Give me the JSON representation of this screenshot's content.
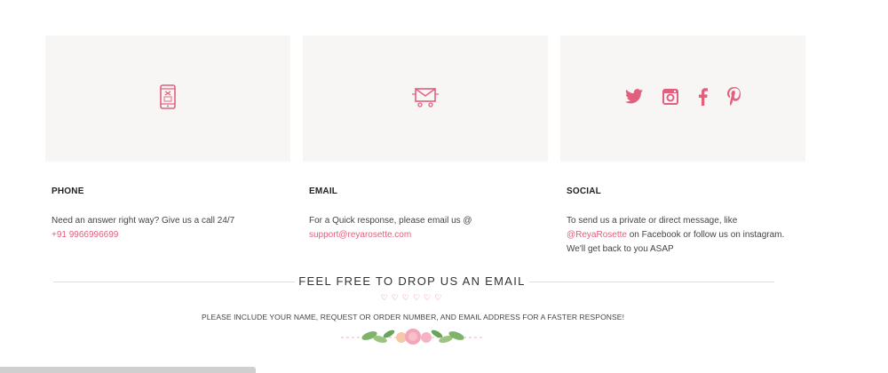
{
  "phone": {
    "heading": "PHONE",
    "text": "Need an answer right way? Give us a call 24/7",
    "number": "+91 9966996699"
  },
  "email": {
    "heading": "EMAIL",
    "text": "For a Quick response, please email us @",
    "address": "support@reyarosette.com"
  },
  "social": {
    "heading": "SOCIAL",
    "text_before": "To send us a private or direct message, like ",
    "handle": "@ReyaRosette",
    "text_after": " on Facebook or follow us on instagram. We'll get back to you ASAP"
  },
  "drop": {
    "title": "FEEL FREE TO DROP US AN EMAIL",
    "hearts": "♡♡♡♡♡♡",
    "note": "PLEASE INCLUDE YOUR NAME, REQUEST OR ORDER NUMBER, AND EMAIL ADDRESS FOR A FASTER RESPONSE!"
  },
  "icons": {
    "phone": "phone-icon",
    "email": "envelope-icon",
    "twitter": "twitter-icon",
    "instagram": "instagram-icon",
    "facebook": "facebook-icon",
    "pinterest": "pinterest-icon"
  },
  "colors": {
    "accent": "#e0607e",
    "card_bg": "#f8f6f4"
  }
}
